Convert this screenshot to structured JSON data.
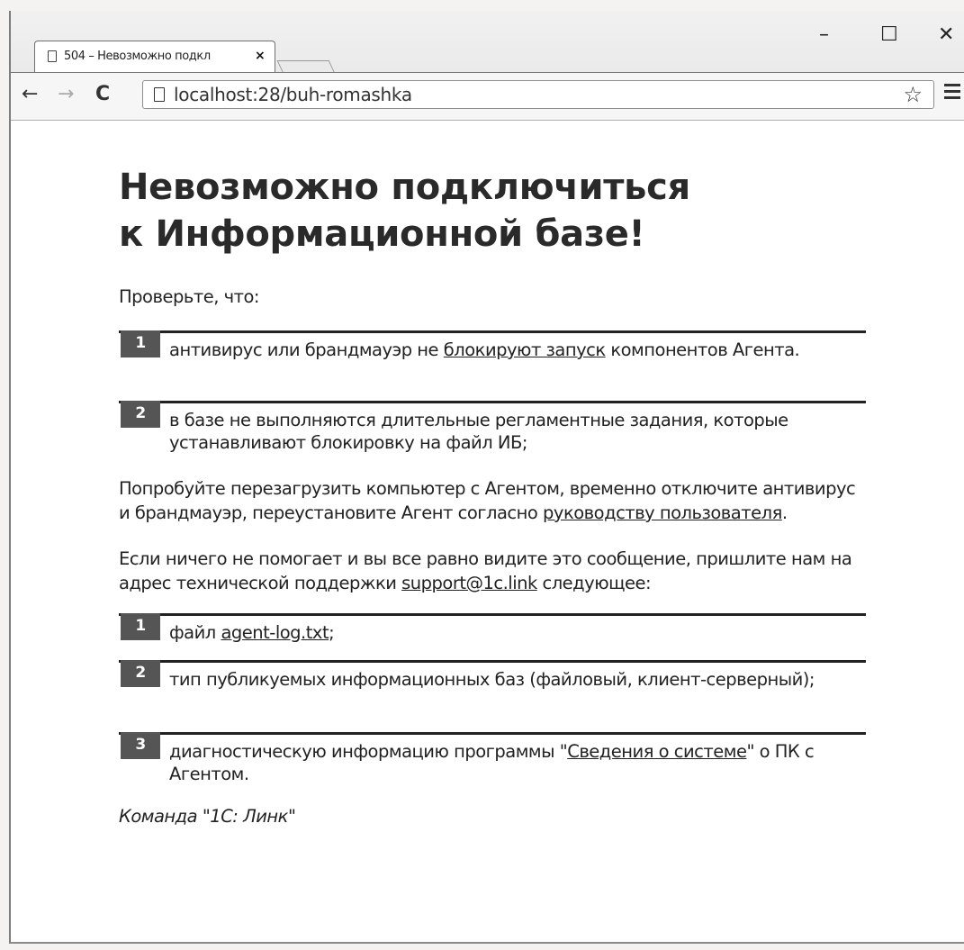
{
  "browser": {
    "tab_title": "504 – Невозможно подкл",
    "tab_close": "×",
    "url": "localhost:28/buh-romashka",
    "window_minimize": "–",
    "window_maximize": "☐",
    "window_close": "✕",
    "back_icon": "←",
    "forward_icon": "→",
    "reload_icon": "C",
    "star_icon": "☆"
  },
  "page": {
    "heading_line1": "Невозможно подключиться",
    "heading_line2": "к Информационной базе!",
    "check_intro": "Проверьте, что:",
    "checks": [
      {
        "num": "1",
        "before": "антивирус или брандмауэр не ",
        "link": "блокируют запуск",
        "after": " компонентов Агента."
      },
      {
        "num": "2",
        "text": "в базе не выполняются длительные регламентные задания, которые устанавливают блокировку на файл ИБ;"
      }
    ],
    "restart_text": "Попробуйте перезагрузить компьютер с Агентом, временно отключите антивирус и брандмауэр, переустановите Агент согласно ",
    "restart_link": "руководству пользователя",
    "restart_end": ".",
    "support_text": "Если ничего не помогает и вы все равно видите это сообщение, пришлите нам на адрес технической поддержки ",
    "support_email": "support@1c.link",
    "support_end": " следующее:",
    "sends": [
      {
        "num": "1",
        "before": "файл ",
        "link": "agent-log.txt",
        "after": ";"
      },
      {
        "num": "2",
        "text": "тип публикуемых информационных баз (файловый, клиент-серверный);"
      },
      {
        "num": "3",
        "before": "диагностическую информацию программы \"",
        "link": "Сведения о системе",
        "after": "\" о ПК с Агентом."
      }
    ],
    "signature": "Команда \"1С: Линк\""
  }
}
